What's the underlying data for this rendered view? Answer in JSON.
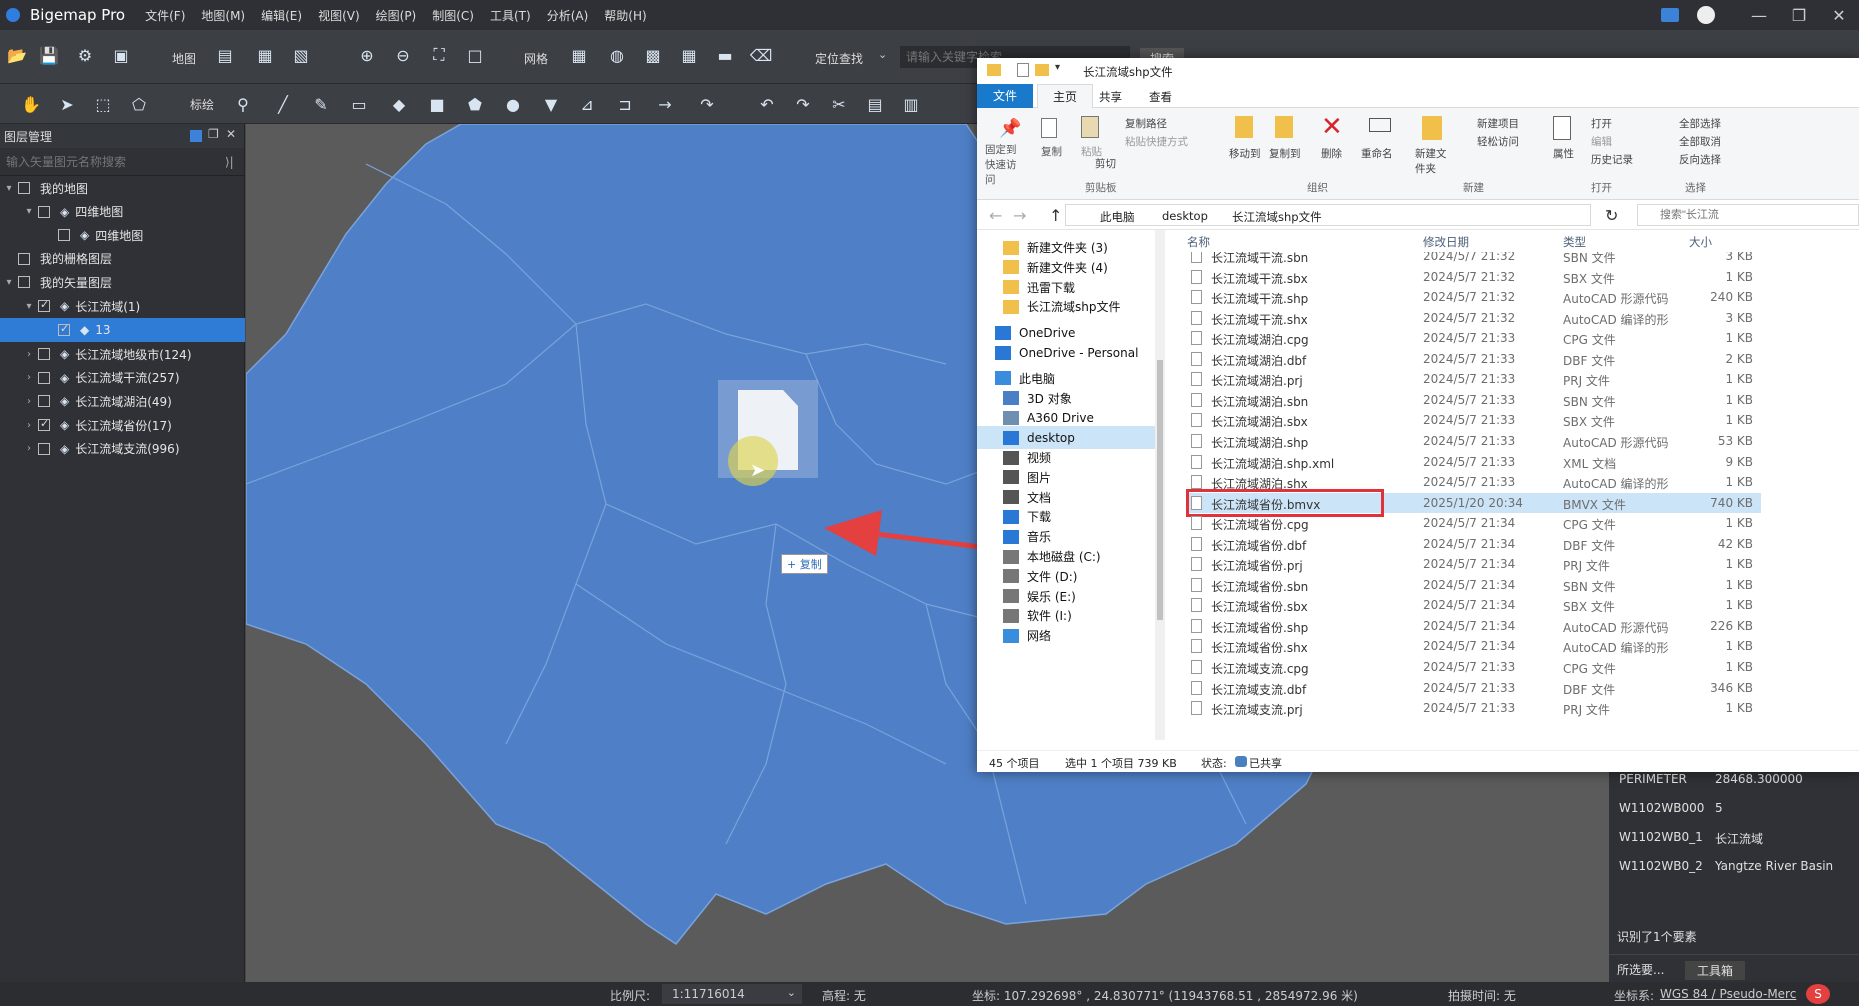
{
  "app": {
    "title": "Bigemap Pro",
    "menus": [
      "文件(F)",
      "地图(M)",
      "编辑(E)",
      "视图(V)",
      "绘图(P)",
      "制图(C)",
      "工具(T)",
      "分析(A)",
      "帮助(H)"
    ]
  },
  "toolbar": {
    "map_label": "地图",
    "grid_label": "网格",
    "locate_label": "定位查找",
    "search_placeholder": "请输入关键字检索",
    "search_button": "搜索",
    "annotate_label": "标绘"
  },
  "layer_panel": {
    "title": "图层管理",
    "filter_placeholder": "输入矢量图元名称搜索",
    "tree": [
      {
        "label": "我的地图",
        "level": 0,
        "arrow": "v",
        "checked": false
      },
      {
        "label": "四维地图",
        "level": 1,
        "arrow": "v",
        "checked": false
      },
      {
        "label": "四维地图",
        "level": 2,
        "arrow": "",
        "checked": false
      },
      {
        "label": "我的栅格图层",
        "level": 0,
        "arrow": "",
        "checked": false
      },
      {
        "label": "我的矢量图层",
        "level": 0,
        "arrow": "v",
        "checked": false
      },
      {
        "label": "长江流域(1)",
        "level": 1,
        "arrow": "v",
        "checked": true
      },
      {
        "label": "13",
        "level": 2,
        "arrow": "",
        "checked": true,
        "selected": true
      },
      {
        "label": "长江流域地级市(124)",
        "level": 1,
        "arrow": ">",
        "checked": false
      },
      {
        "label": "长江流域干流(257)",
        "level": 1,
        "arrow": ">",
        "checked": false
      },
      {
        "label": "长江流域湖泊(49)",
        "level": 1,
        "arrow": ">",
        "checked": false
      },
      {
        "label": "长江流域省份(17)",
        "level": 1,
        "arrow": ">",
        "checked": true
      },
      {
        "label": "长江流域支流(996)",
        "level": 1,
        "arrow": ">",
        "checked": false
      }
    ]
  },
  "drag": {
    "copy_label": "+ 复制"
  },
  "explorer": {
    "title": "长江流域shp文件",
    "tabs": [
      "文件",
      "主页",
      "共享",
      "查看"
    ],
    "ribbon": {
      "pin": "固定到快速访问",
      "copy": "复制",
      "paste": "粘贴",
      "copy_path": "复制路径",
      "paste_shortcut": "粘贴快捷方式",
      "cut": "剪切",
      "clipboard": "剪贴板",
      "move_to": "移动到",
      "copy_to": "复制到",
      "delete": "删除",
      "rename": "重命名",
      "organize": "组织",
      "new_folder": "新建文件夹",
      "new_item": "新建项目",
      "easy_access": "轻松访问",
      "new_group": "新建",
      "properties": "属性",
      "open": "打开",
      "edit": "编辑",
      "history": "历史记录",
      "open_group": "打开",
      "select_all": "全部选择",
      "select_none": "全部取消",
      "invert": "反向选择",
      "select_group": "选择"
    },
    "breadcrumb": [
      "此电脑",
      "desktop",
      "长江流域shp文件"
    ],
    "search_placeholder": "搜索\"长江流",
    "columns": [
      "名称",
      "修改日期",
      "类型",
      "大小"
    ],
    "nav": [
      {
        "label": "新建文件夹 (3)",
        "icon": "folder"
      },
      {
        "label": "新建文件夹 (4)",
        "icon": "folder"
      },
      {
        "label": "迅雷下载",
        "icon": "folder"
      },
      {
        "label": "长江流域shp文件",
        "icon": "folder"
      },
      {
        "label": "OneDrive",
        "icon": "cloud"
      },
      {
        "label": "OneDrive - Personal",
        "icon": "cloud"
      },
      {
        "label": "此电脑",
        "icon": "pc"
      },
      {
        "label": "3D 对象",
        "icon": "obj3d"
      },
      {
        "label": "A360 Drive",
        "icon": "drive"
      },
      {
        "label": "desktop",
        "icon": "desk"
      },
      {
        "label": "视频",
        "icon": "video"
      },
      {
        "label": "图片",
        "icon": "pic"
      },
      {
        "label": "文档",
        "icon": "doc"
      },
      {
        "label": "下载",
        "icon": "down"
      },
      {
        "label": "音乐",
        "icon": "music"
      },
      {
        "label": "本地磁盘 (C:)",
        "icon": "disk"
      },
      {
        "label": "文件 (D:)",
        "icon": "disk"
      },
      {
        "label": "娱乐 (E:)",
        "icon": "disk"
      },
      {
        "label": "软件 (I:)",
        "icon": "disk"
      },
      {
        "label": "网络",
        "icon": "net"
      }
    ],
    "files": [
      {
        "name": "长江流域干流.sbn",
        "date": "2024/5/7 21:32",
        "type": "SBN 文件",
        "size": "3 KB"
      },
      {
        "name": "长江流域干流.sbx",
        "date": "2024/5/7 21:32",
        "type": "SBX 文件",
        "size": "1 KB"
      },
      {
        "name": "长江流域干流.shp",
        "date": "2024/5/7 21:32",
        "type": "AutoCAD 形源代码",
        "size": "240 KB"
      },
      {
        "name": "长江流域干流.shx",
        "date": "2024/5/7 21:32",
        "type": "AutoCAD 编译的形",
        "size": "3 KB"
      },
      {
        "name": "长江流域湖泊.cpg",
        "date": "2024/5/7 21:33",
        "type": "CPG 文件",
        "size": "1 KB"
      },
      {
        "name": "长江流域湖泊.dbf",
        "date": "2024/5/7 21:33",
        "type": "DBF 文件",
        "size": "2 KB"
      },
      {
        "name": "长江流域湖泊.prj",
        "date": "2024/5/7 21:33",
        "type": "PRJ 文件",
        "size": "1 KB"
      },
      {
        "name": "长江流域湖泊.sbn",
        "date": "2024/5/7 21:33",
        "type": "SBN 文件",
        "size": "1 KB"
      },
      {
        "name": "长江流域湖泊.sbx",
        "date": "2024/5/7 21:33",
        "type": "SBX 文件",
        "size": "1 KB"
      },
      {
        "name": "长江流域湖泊.shp",
        "date": "2024/5/7 21:33",
        "type": "AutoCAD 形源代码",
        "size": "53 KB"
      },
      {
        "name": "长江流域湖泊.shp.xml",
        "date": "2024/5/7 21:33",
        "type": "XML 文档",
        "size": "9 KB"
      },
      {
        "name": "长江流域湖泊.shx",
        "date": "2024/5/7 21:33",
        "type": "AutoCAD 编译的形",
        "size": "1 KB"
      },
      {
        "name": "长江流域省份.bmvx",
        "date": "2025/1/20 20:34",
        "type": "BMVX 文件",
        "size": "740 KB",
        "selected": true
      },
      {
        "name": "长江流域省份.cpg",
        "date": "2024/5/7 21:34",
        "type": "CPG 文件",
        "size": "1 KB"
      },
      {
        "name": "长江流域省份.dbf",
        "date": "2024/5/7 21:34",
        "type": "DBF 文件",
        "size": "42 KB"
      },
      {
        "name": "长江流域省份.prj",
        "date": "2024/5/7 21:34",
        "type": "PRJ 文件",
        "size": "1 KB"
      },
      {
        "name": "长江流域省份.sbn",
        "date": "2024/5/7 21:34",
        "type": "SBN 文件",
        "size": "1 KB"
      },
      {
        "name": "长江流域省份.sbx",
        "date": "2024/5/7 21:34",
        "type": "SBX 文件",
        "size": "1 KB"
      },
      {
        "name": "长江流域省份.shp",
        "date": "2024/5/7 21:34",
        "type": "AutoCAD 形源代码",
        "size": "226 KB"
      },
      {
        "name": "长江流域省份.shx",
        "date": "2024/5/7 21:34",
        "type": "AutoCAD 编译的形",
        "size": "1 KB"
      },
      {
        "name": "长江流域支流.cpg",
        "date": "2024/5/7 21:33",
        "type": "CPG 文件",
        "size": "1 KB"
      },
      {
        "name": "长江流域支流.dbf",
        "date": "2024/5/7 21:33",
        "type": "DBF 文件",
        "size": "346 KB"
      },
      {
        "name": "长江流域支流.prj",
        "date": "2024/5/7 21:33",
        "type": "PRJ 文件",
        "size": "1 KB"
      }
    ],
    "status": {
      "count": "45 个项目",
      "selected": "选中 1 个项目  739 KB",
      "state": "状态:",
      "shared": "已共享"
    }
  },
  "properties": {
    "rows": [
      {
        "key": "PERIMETER",
        "value": "28468.300000"
      },
      {
        "key": "W1102WB000",
        "value": "5"
      },
      {
        "key": "W1102WB0_1",
        "value": "长江流域"
      },
      {
        "key": "W1102WB0_2",
        "value": "Yangtze River Basin"
      }
    ],
    "found": "识别了1个要素",
    "tab1": "所选要...",
    "tab2": "工具箱"
  },
  "statusbar": {
    "scale_label": "比例尺:",
    "scale_value": "1:11716014",
    "elev": "高程: 无",
    "coords": "坐标: 107.292698° , 24.830771°  (11943768.51 , 2854972.96 米)",
    "shot_time": "拍摄时间: 无",
    "crs_label": "坐标系:",
    "crs_value": "WGS 84 / Pseudo-Merc"
  },
  "colors": {
    "accent": "#2e7cd6",
    "map_fill": "#4f7fc6",
    "map_stroke": "#7aa3dc",
    "arrow": "#e3403f",
    "highlight": "#e1323a"
  }
}
